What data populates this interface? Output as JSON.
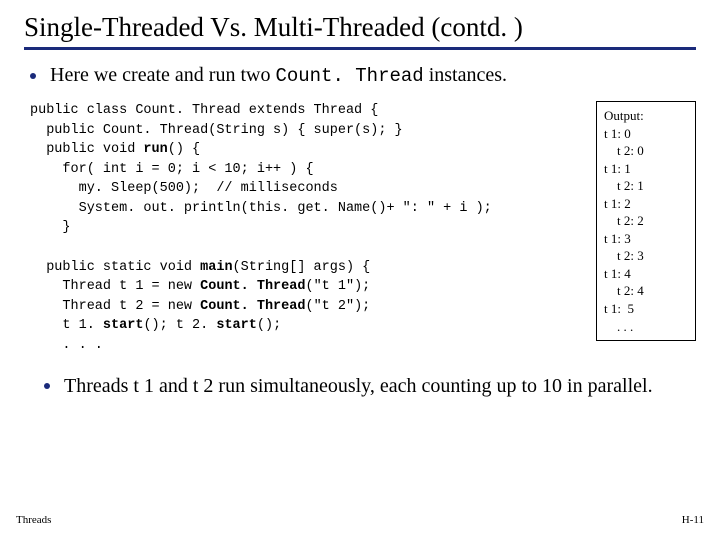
{
  "title": "Single-Threaded Vs. Multi-Threaded (contd. )",
  "bullet1_pre": "Here we create and run two ",
  "bullet1_mono": "Count. Thread",
  "bullet1_post": " instances.",
  "code_html": "public class Count. Thread extends Thread {\n  public Count. Thread(String s) { super(s); }\n  public void <b>run</b>() {\n    for( int i = 0; i < 10; i++ ) {\n      my. Sleep(500);  // milliseconds\n      System. out. println(this. get. Name()+ \": \" + i );\n    }\n\n  public static void <b>main</b>(String[] args) {\n    Thread t 1 = new <b>Count. Thread</b>(\"t 1\");\n    Thread t 2 = new <b>Count. Thread</b>(\"t 2\");\n    t 1. <b>start</b>(); t 2. <b>start</b>();\n    . . .",
  "output_text": "Output:\nt 1: 0\n    t 2: 0\nt 1: 1\n    t 2: 1\nt 1: 2\n    t 2: 2\nt 1: 3\n    t 2: 3\nt 1: 4\n    t 2: 4\nt 1:  5\n    . . .",
  "bullet2": "Threads t 1 and t 2  run simultaneously, each counting up to 10 in parallel.",
  "footer_left": "Threads",
  "footer_right": "H-11"
}
